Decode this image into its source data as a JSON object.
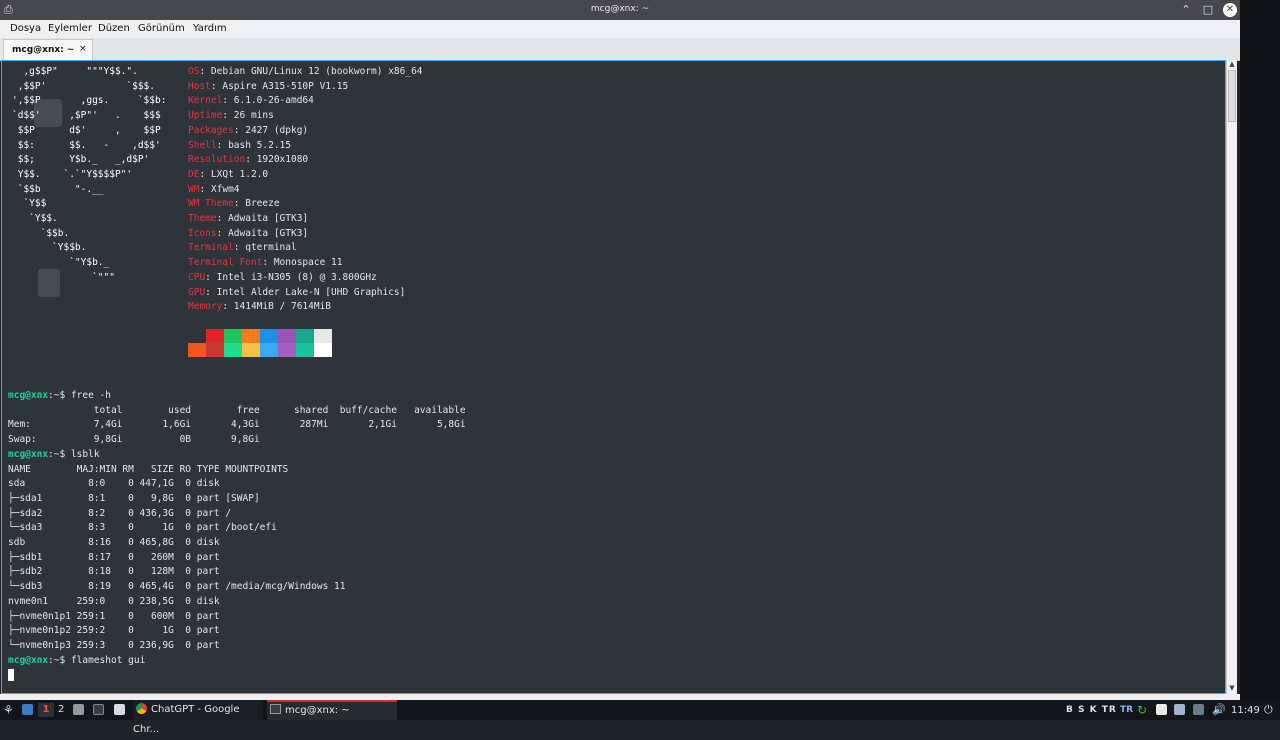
{
  "window": {
    "title": "mcg@xnx: ~",
    "app_icon": "terminal-icon",
    "controls": [
      "minimize-icon",
      "maximize-icon",
      "close-icon"
    ]
  },
  "menu": [
    "Dosya",
    "Eylemler",
    "Düzen",
    "Görünüm",
    "Yardım"
  ],
  "tab": {
    "label": "mcg@xnx: ~",
    "close": "×"
  },
  "logo_lines": [
    "  ,g$$P\"     \"\"\"Y$$.\".",
    " ,$$P'              `$$$.",
    "',$$P       ,ggs.     `$$b:",
    "`d$$'     ,$P\"'   .    $$$",
    " $$P      d$'     ,    $$P",
    " $$:      $$.   -    ,d$$'",
    " $$;      Y$b._   _,d$P'",
    " Y$$.    `.`\"Y$$$$P\"'",
    " `$$b      \"-.__",
    "  `Y$$",
    "   `Y$$.",
    "     `$$b.",
    "       `Y$$b.",
    "          `\"Y$b._",
    "              `\"\"\""
  ],
  "sysinfo": [
    {
      "key": "OS",
      "value": "Debian GNU/Linux 12 (bookworm) x86_64"
    },
    {
      "key": "Host",
      "value": "Aspire A315-510P V1.15"
    },
    {
      "key": "Kernel",
      "value": "6.1.0-26-amd64"
    },
    {
      "key": "Uptime",
      "value": "26 mins"
    },
    {
      "key": "Packages",
      "value": "2427 (dpkg)"
    },
    {
      "key": "Shell",
      "value": "bash 5.2.15"
    },
    {
      "key": "Resolution",
      "value": "1920x1080"
    },
    {
      "key": "DE",
      "value": "LXQt 1.2.0"
    },
    {
      "key": "WM",
      "value": "Xfwm4"
    },
    {
      "key": "WM Theme",
      "value": "Breeze"
    },
    {
      "key": "Theme",
      "value": "Adwaita [GTK3]"
    },
    {
      "key": "Icons",
      "value": "Adwaita [GTK3]"
    },
    {
      "key": "Terminal",
      "value": "qterminal"
    },
    {
      "key": "Terminal Font",
      "value": "Monospace 11"
    },
    {
      "key": "CPU",
      "value": "Intel i3-N305 (8) @ 3.800GHz"
    },
    {
      "key": "GPU",
      "value": "Intel Alder Lake-N [UHD Graphics]"
    },
    {
      "key": "Memory",
      "value": "1414MiB / 7614MiB"
    }
  ],
  "palette": {
    "row1": [
      "#2e343a",
      "#e0242e",
      "#1ec55a",
      "#f07c1e",
      "#1e8fe6",
      "#9b55b6",
      "#19a68f",
      "#e8e8e8"
    ],
    "row2": [
      "#f0561e",
      "#c23b2e",
      "#26d98f",
      "#f6bf45",
      "#3aa9f0",
      "#a35fbf",
      "#1cc29a",
      "#ffffff"
    ]
  },
  "terminal_lines": [
    {
      "prompt": "mcg@xnx",
      "sep": ":~$ ",
      "cmd": "free -h"
    },
    {
      "text": "               total        used        free      shared  buff/cache   available"
    },
    {
      "text": "Mem:           7,4Gi       1,6Gi       4,3Gi       287Mi       2,1Gi       5,8Gi"
    },
    {
      "text": "Swap:          9,8Gi          0B       9,8Gi"
    },
    {
      "prompt": "mcg@xnx",
      "sep": ":~$ ",
      "cmd": "lsblk"
    },
    {
      "text": "NAME        MAJ:MIN RM   SIZE RO TYPE MOUNTPOINTS"
    },
    {
      "text": "sda           8:0    0 447,1G  0 disk"
    },
    {
      "text": "├─sda1        8:1    0   9,8G  0 part [SWAP]"
    },
    {
      "text": "├─sda2        8:2    0 436,3G  0 part /"
    },
    {
      "text": "└─sda3        8:3    0     1G  0 part /boot/efi"
    },
    {
      "text": "sdb           8:16   0 465,8G  0 disk"
    },
    {
      "text": "├─sdb1        8:17   0   260M  0 part"
    },
    {
      "text": "├─sdb2        8:18   0   128M  0 part"
    },
    {
      "text": "└─sdb3        8:19   0 465,4G  0 part /media/mcg/Windows 11"
    },
    {
      "text": "nvme0n1     259:0    0 238,5G  0 disk"
    },
    {
      "text": "├─nvme0n1p1 259:1    0   600M  0 part"
    },
    {
      "text": "├─nvme0n1p2 259:2    0     1G  0 part"
    },
    {
      "text": "└─nvme0n1p3 259:3    0 236,9G  0 part"
    },
    {
      "prompt": "mcg@xnx",
      "sep": ":~$ ",
      "cmd": "flameshot gui"
    }
  ],
  "taskbar": {
    "start_icon": "lxqt-menu-icon",
    "desktops": [
      "1",
      "2"
    ],
    "quicklaunch": [
      "files-icon",
      "terminal-icon",
      "text-editor-icon"
    ],
    "tasks": [
      {
        "icon": "chrome-icon",
        "label": "ChatGPT - Google Chr..."
      },
      {
        "icon": "terminal-icon",
        "label": "mcg@xnx: ~"
      }
    ],
    "tray_text": "B S K TR",
    "kbd_layout": "TR",
    "tray_icons": [
      "update-icon",
      "clipboard-icon",
      "screenshot-icon",
      "network-icon",
      "volume-icon",
      "power-icon"
    ],
    "clock": "11:49"
  },
  "colors": {
    "prompt": "#1dd1a1",
    "key_label": "#e23440",
    "terminal_bg": "#2e343a",
    "focus_border": "#3fa9f5"
  }
}
